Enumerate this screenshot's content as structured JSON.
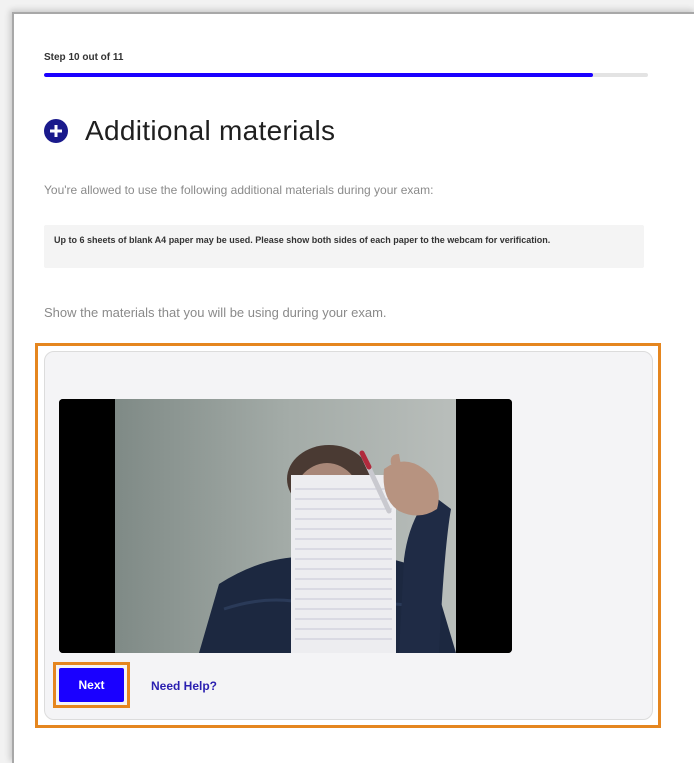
{
  "progress": {
    "step_label": "Step 10 out of 11",
    "fraction": 0.909,
    "accent_color": "#1a00ff"
  },
  "header": {
    "icon": "plus-circle-icon",
    "title": "Additional materials"
  },
  "content": {
    "intro": "You're allowed to use the following additional materials during your exam:",
    "materials_note": "Up to 6 sheets of blank A4 paper may be used. Please show both sides of each paper to the webcam for verification.",
    "instruction": "Show the materials that you will be using during your exam."
  },
  "webcam": {
    "highlight_color": "#e5861f"
  },
  "actions": {
    "next_label": "Next",
    "help_label": "Need Help?"
  }
}
